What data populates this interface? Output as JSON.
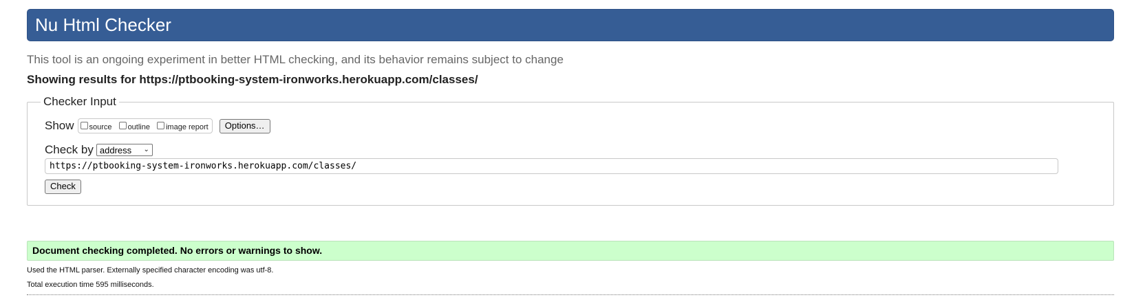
{
  "header": {
    "title": "Nu Html Checker"
  },
  "tagline": "This tool is an ongoing experiment in better HTML checking, and its behavior remains subject to change",
  "results_heading": "Showing results for https://ptbooking-system-ironworks.herokuapp.com/classes/",
  "checker_input": {
    "legend": "Checker Input",
    "show_label": "Show",
    "checkboxes": [
      {
        "label": "source",
        "checked": false
      },
      {
        "label": "outline",
        "checked": false
      },
      {
        "label": "image report",
        "checked": false
      }
    ],
    "options_button": "Options…",
    "check_by_label": "Check by",
    "check_by_selected": "address",
    "url_value": "https://ptbooking-system-ironworks.herokuapp.com/classes/",
    "check_button": "Check"
  },
  "result": {
    "status": "Document checking completed. No errors or warnings to show.",
    "status_color": "#ccffcc",
    "parser_info": "Used the HTML parser. Externally specified character encoding was utf-8.",
    "execution_time": "Total execution time 595 milliseconds."
  },
  "colors": {
    "header_bg": "#365d95",
    "success_bg": "#ccffcc"
  }
}
